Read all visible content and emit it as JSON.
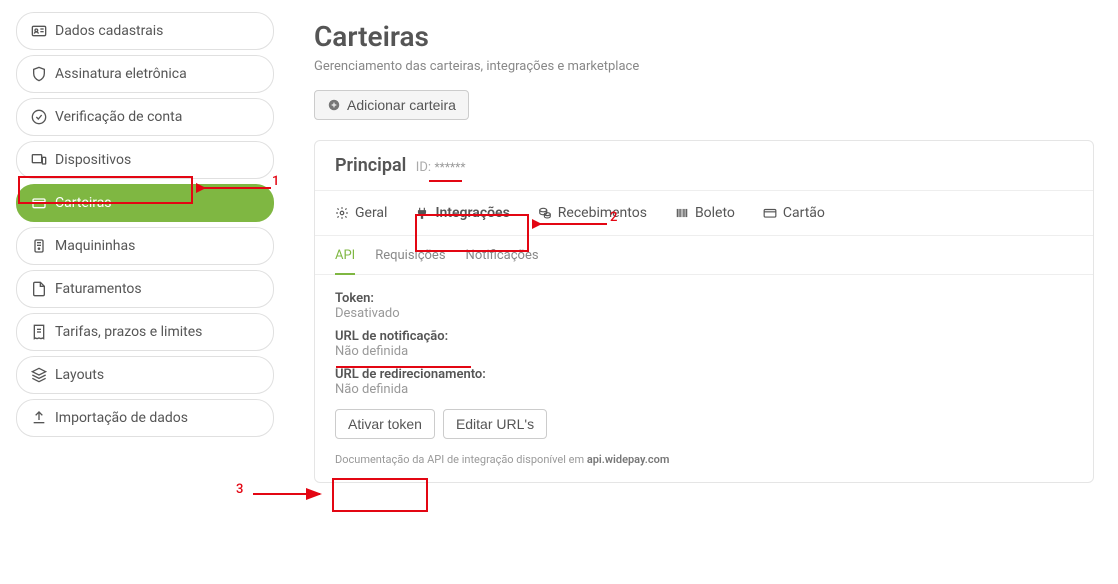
{
  "sidebar": {
    "items": [
      {
        "icon": "id-card",
        "label": "Dados cadastrais"
      },
      {
        "icon": "shield",
        "label": "Assinatura eletrônica"
      },
      {
        "icon": "check-circle",
        "label": "Verificação de conta"
      },
      {
        "icon": "devices",
        "label": "Dispositivos"
      },
      {
        "icon": "wallet",
        "label": "Carteiras",
        "active": true
      },
      {
        "icon": "card-reader",
        "label": "Maquininhas"
      },
      {
        "icon": "file",
        "label": "Faturamentos"
      },
      {
        "icon": "receipt",
        "label": "Tarifas, prazos e limites"
      },
      {
        "icon": "layers",
        "label": "Layouts"
      },
      {
        "icon": "upload",
        "label": "Importação de dados"
      }
    ]
  },
  "page": {
    "title": "Carteiras",
    "subtitle": "Gerenciamento das carteiras, integrações e marketplace",
    "add_button": "Adicionar carteira"
  },
  "wallet": {
    "name": "Principal",
    "id_label": "ID:",
    "id_value": "******"
  },
  "tabs": {
    "items": [
      {
        "icon": "gear",
        "label": "Geral"
      },
      {
        "icon": "plug",
        "label": "Integrações",
        "active": true
      },
      {
        "icon": "coins",
        "label": "Recebimentos"
      },
      {
        "icon": "barcode",
        "label": "Boleto"
      },
      {
        "icon": "credit-card",
        "label": "Cartão"
      }
    ]
  },
  "subtabs": {
    "items": [
      {
        "label": "API",
        "active": true
      },
      {
        "label": "Requisições"
      },
      {
        "label": "Notificações"
      }
    ]
  },
  "api": {
    "token_label": "Token:",
    "token_value": "Desativado",
    "notify_label": "URL de notificação:",
    "notify_value": "Não definida",
    "redirect_label": "URL de redirecionamento:",
    "redirect_value": "Não definida",
    "activate_btn": "Ativar token",
    "edit_urls_btn": "Editar URL's",
    "doc_prefix": "Documentação da API de integração disponível em ",
    "doc_link": "api.widepay.com"
  },
  "annotations": {
    "a1": "1",
    "a2": "2",
    "a3": "3"
  }
}
